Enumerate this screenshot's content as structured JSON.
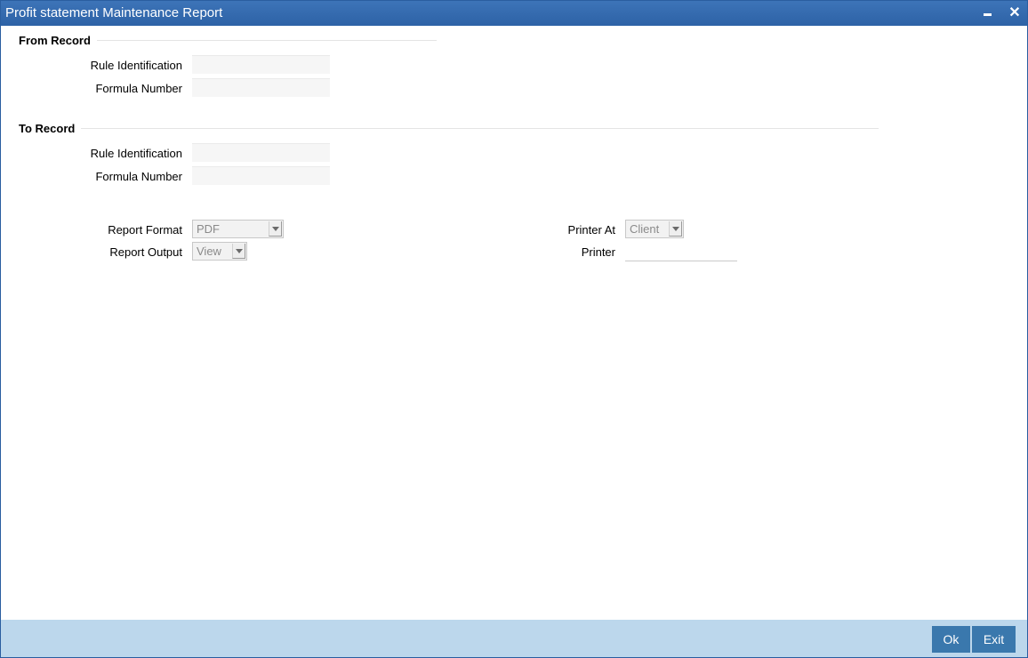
{
  "window": {
    "title": "Profit statement Maintenance Report"
  },
  "from_record": {
    "heading": "From Record",
    "rule_identification_label": "Rule Identification",
    "rule_identification_value": "",
    "formula_number_label": "Formula Number",
    "formula_number_value": ""
  },
  "to_record": {
    "heading": "To Record",
    "rule_identification_label": "Rule Identification",
    "rule_identification_value": "",
    "formula_number_label": "Formula Number",
    "formula_number_value": ""
  },
  "report": {
    "format_label": "Report Format",
    "format_value": "PDF",
    "output_label": "Report Output",
    "output_value": "View",
    "printer_at_label": "Printer At",
    "printer_at_value": "Client",
    "printer_label": "Printer",
    "printer_value": ""
  },
  "footer": {
    "ok_label": "Ok",
    "exit_label": "Exit"
  },
  "colors": {
    "titlebar": "#2d62a6",
    "footer": "#bcd7ec",
    "button": "#3a78ad"
  },
  "icons": {
    "minimize": "minimize-icon",
    "close": "close-icon",
    "dropdown": "chevron-down-icon"
  }
}
